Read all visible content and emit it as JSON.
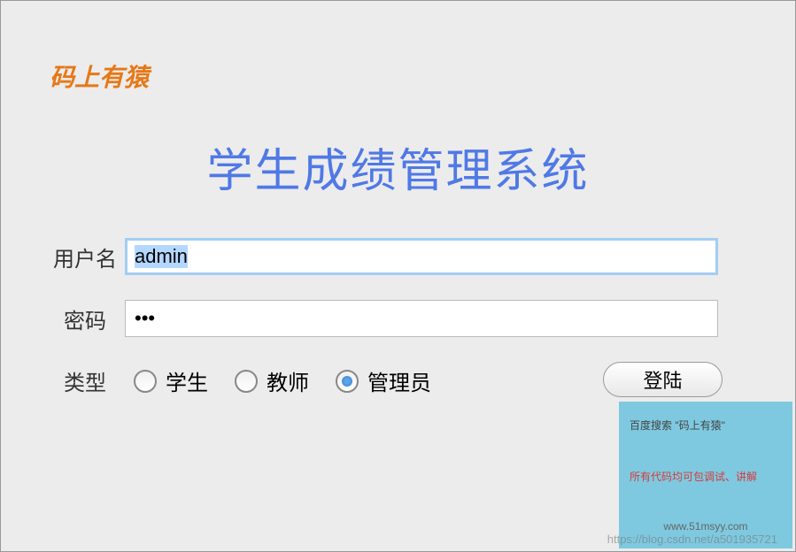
{
  "brand": "码上有猿",
  "title": "学生成绩管理系统",
  "form": {
    "username_label": "用户名",
    "username_value": "admin",
    "password_label": "密码",
    "password_value": "•••",
    "type_label": "类型",
    "radio_options": {
      "student": "学生",
      "teacher": "教师",
      "admin": "管理员"
    },
    "selected_type": "admin",
    "login_button": "登陆"
  },
  "infobox": {
    "line1": "百度搜索 \"码上有猿\"",
    "line2": "所有代码均可包调试、讲解",
    "line3": "www.51msyy.com"
  },
  "watermark": "https://blog.csdn.net/a501935721"
}
